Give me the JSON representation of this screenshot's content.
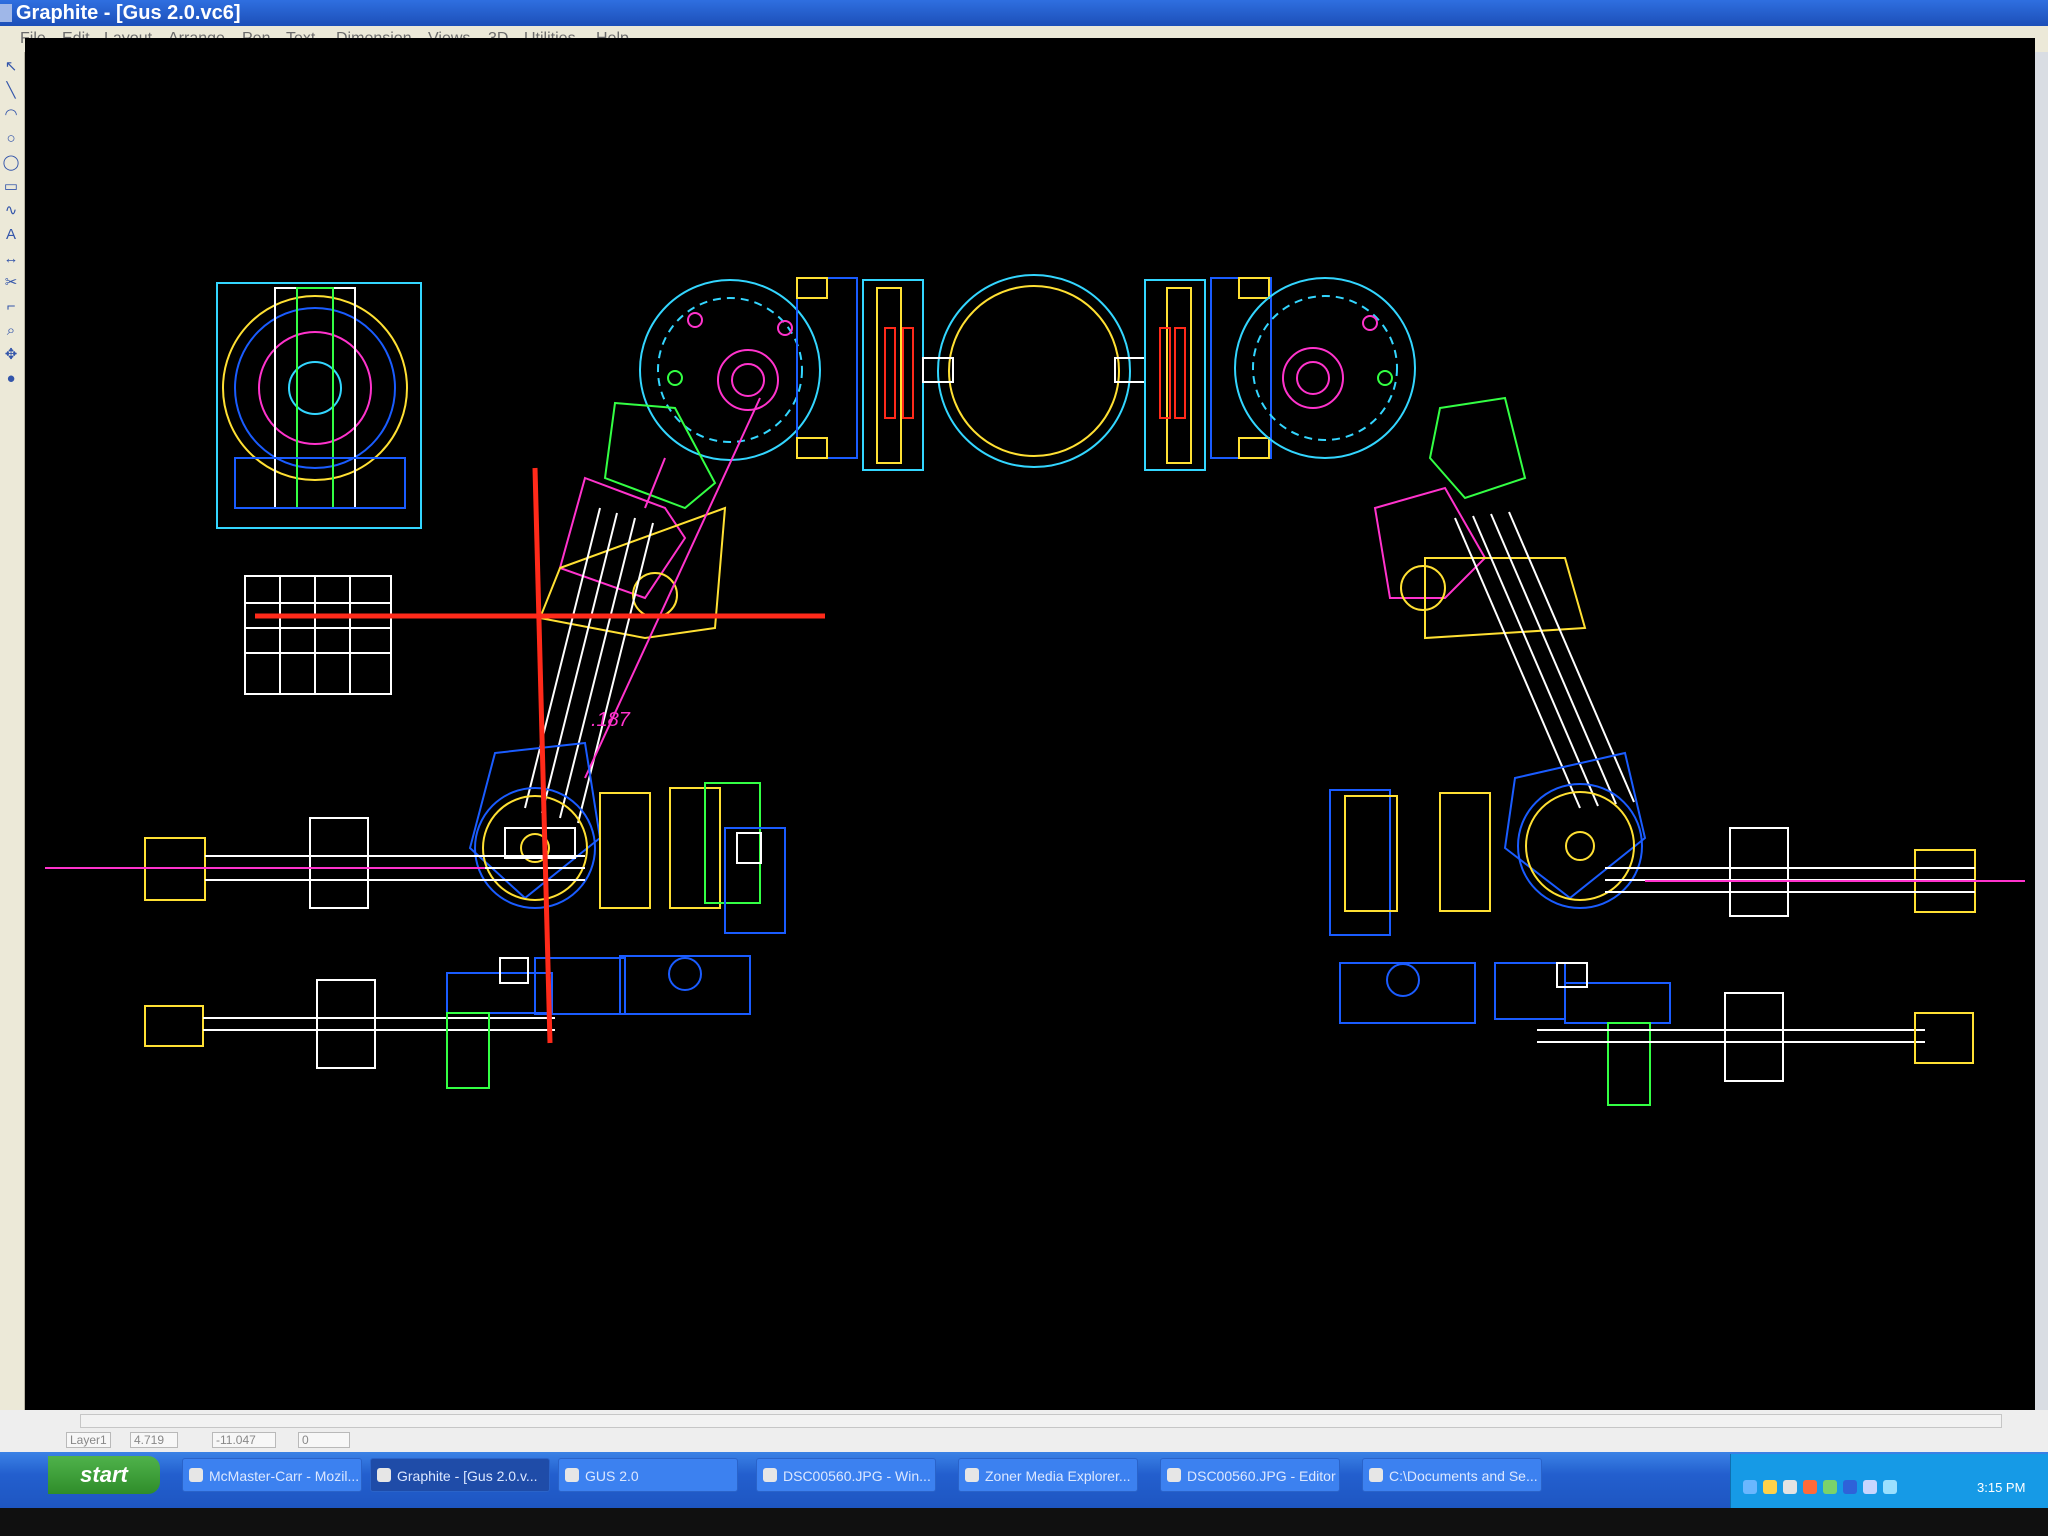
{
  "window": {
    "title": "Graphite - [Gus 2.0.vc6]"
  },
  "menu": [
    "File",
    "Edit",
    "Layout",
    "Arrange",
    "Pen",
    "Text",
    "Dimension",
    "Views",
    "3D",
    "Utilities",
    "Help"
  ],
  "toolbar": [
    "select-icon",
    "line-icon",
    "arc-icon",
    "circle-icon",
    "ellipse-icon",
    "rectangle-icon",
    "spline-icon",
    "text-icon",
    "dimension-icon",
    "trim-icon",
    "fillet-icon",
    "zoom-icon",
    "pan-icon",
    "snap-icon"
  ],
  "drawing": {
    "dimension_label": ".187",
    "colors": {
      "background": "#000000",
      "cyan": "#33d6ff",
      "blue": "#1a5cff",
      "yellow": "#ffe033",
      "magenta": "#ff33cc",
      "green": "#33ff44",
      "white": "#ffffff",
      "red": "#ff2a1a"
    }
  },
  "status": {
    "layer": "Layer1",
    "x": "4.719",
    "y": "-11.047",
    "z": "0"
  },
  "taskbar": {
    "start_label": "start",
    "tasks": [
      {
        "label": "McMaster-Carr - Mozil...",
        "active": false
      },
      {
        "label": "Graphite - [Gus 2.0.v...",
        "active": true
      },
      {
        "label": "GUS 2.0",
        "active": false
      },
      {
        "label": "DSC00560.JPG - Win...",
        "active": false
      },
      {
        "label": "Zoner Media Explorer...",
        "active": false
      },
      {
        "label": "DSC00560.JPG - Editor",
        "active": false
      },
      {
        "label": "C:\\Documents and Se...",
        "active": false
      }
    ],
    "clock": "3:15 PM"
  }
}
